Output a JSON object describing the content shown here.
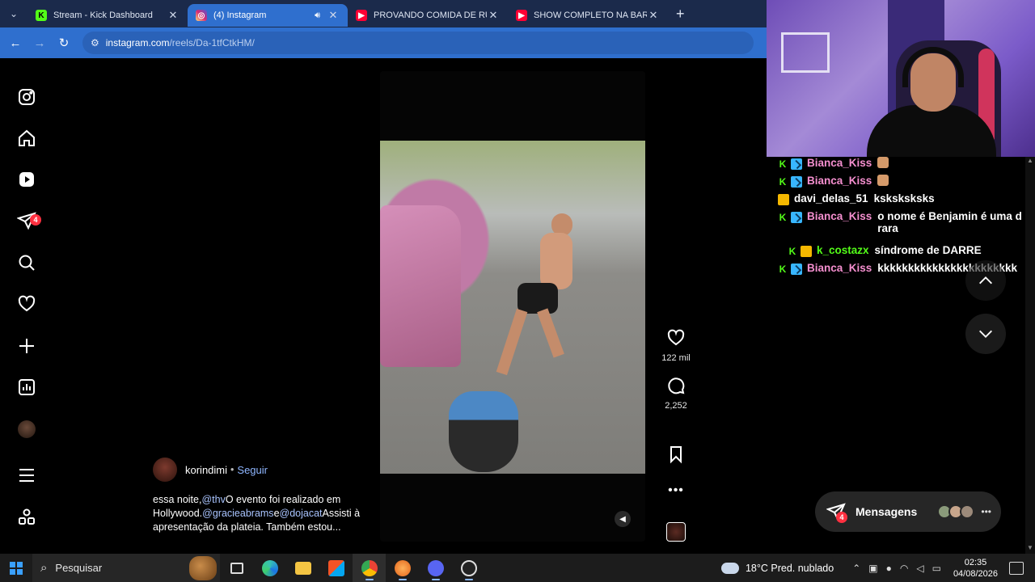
{
  "browser": {
    "tabs": [
      {
        "title": "Stream - Kick Dashboard",
        "favicon": "kick-icon",
        "active": false
      },
      {
        "title": "(4) Instagram",
        "favicon": "instagram-icon",
        "active": true,
        "audio": true
      },
      {
        "title": "PROVANDO COMIDA DE RUA E",
        "favicon": "youtube-icon",
        "active": false
      },
      {
        "title": "SHOW COMPLETO NA BARRA I",
        "favicon": "youtube-icon",
        "active": false
      }
    ],
    "url_host": "instagram.com",
    "url_path": "/reels/Da-1tfCtkHM/"
  },
  "sidebar": {
    "notifications_badge": "4"
  },
  "reel": {
    "likes": "122 mil",
    "comments": "2,252",
    "author": "korindimi",
    "separator": "•",
    "follow_label": "Seguir",
    "caption": {
      "part1": "essa noite,",
      "mention1": "@thv",
      "part2": "O evento foi realizado em Hollywood.",
      "mention2": "@gracieabrams",
      "part3": "e",
      "mention3": "@dojacat",
      "part4": "Assisti à apresentação da plateia. Também estou..."
    }
  },
  "chat": {
    "lines": [
      {
        "user": "Bianca_Kiss",
        "color": "#f58fcf",
        "badge": "sub",
        "message": "",
        "emote": true
      },
      {
        "user": "Bianca_Kiss",
        "color": "#f58fcf",
        "badge": "sub",
        "message": "",
        "emote": true
      },
      {
        "user": "davi_delas_51",
        "color": "#ffffff",
        "badge": "crown",
        "message": "ksksksksks",
        "emote": false
      },
      {
        "user": "Bianca_Kiss",
        "color": "#f58fcf",
        "badge": "sub",
        "message": "o nome é Benjamin é uma d",
        "message2": "rara",
        "emote": false
      },
      {
        "user": "k_costazx",
        "color": "#53fc18",
        "badge": "crown",
        "message": "síndrome de DARRE",
        "emote": false
      },
      {
        "user": "Bianca_Kiss",
        "color": "#f58fcf",
        "badge": "sub",
        "message": "kkkkkkkkkkkkkkkkkkkkkkk",
        "emote": false
      }
    ]
  },
  "messages": {
    "label": "Mensagens",
    "badge": "4"
  },
  "taskbar": {
    "search_placeholder": "Pesquisar",
    "weather": "18°C  Pred. nublado",
    "time": "02:35",
    "date": "04/08/2026"
  },
  "colors": {
    "instagram_bg": "#000000",
    "chrome_blue": "#2f6fce",
    "kick_green": "#53fc18",
    "badge_red": "#ff3040"
  }
}
